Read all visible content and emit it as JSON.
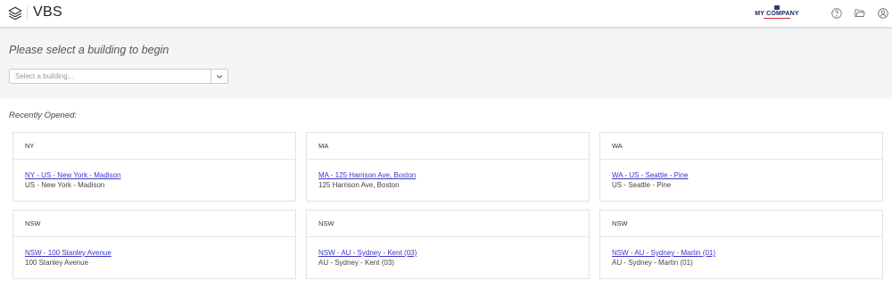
{
  "header": {
    "app_title": "VBS",
    "logo_icon": "layers-icon",
    "company": {
      "name": "MY COMPANY"
    },
    "icons": [
      "help-icon",
      "folder-icon",
      "user-icon"
    ]
  },
  "hero": {
    "prompt": "Please select a building to begin",
    "select": {
      "placeholder": "Select a building...",
      "icon": "chevron-down-icon"
    }
  },
  "recent": {
    "title": "Recently Opened:",
    "cards": [
      {
        "code": "NY",
        "link": "NY - US - New York - Madison",
        "sub": "US - New York - Madison"
      },
      {
        "code": "MA",
        "link": "MA - 125 Harrison Ave, Boston",
        "sub": "125 Harrison Ave, Boston"
      },
      {
        "code": "WA",
        "link": "WA - US - Seattle - Pine",
        "sub": "US - Seattle - Pine"
      },
      {
        "code": "NSW",
        "link": "NSW - 100 Stanley Avenue",
        "sub": "100 Stanley Avenue"
      },
      {
        "code": "NSW",
        "link": "NSW - AU - Sydney - Kent (03)",
        "sub": "AU - Sydney - Kent (03)"
      },
      {
        "code": "NSW",
        "link": "NSW - AU - Sydney - Martin (01)",
        "sub": "AU - Sydney - Martin (01)"
      }
    ]
  },
  "colors": {
    "link": "#3b37c9",
    "hero_bg": "#f4f5f7",
    "brand_navy": "#1a2860"
  }
}
